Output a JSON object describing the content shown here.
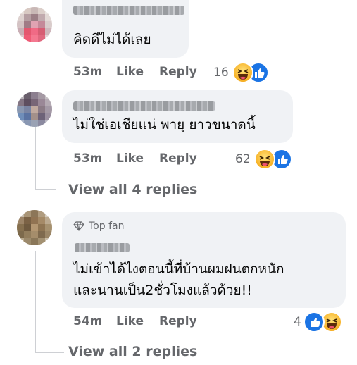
{
  "comments": [
    {
      "text": "คิดดีไม่ได้เลย",
      "time": "53m",
      "like_label": "Like",
      "reply_label": "Reply",
      "reaction_count": "16"
    },
    {
      "text": "ไม่ใช่เอเชียแน่ พายุ ยาวขนาดนี้",
      "time": "53m",
      "like_label": "Like",
      "reply_label": "Reply",
      "reaction_count": "62"
    },
    {
      "badge": "Top fan",
      "text_line1": "ไม่เข้าได้ไงตอนนี้ที่บ้านผมฝนตกหนัก",
      "text_line2": "และนานเป็น2ชั่วโมงแล้วด้วย!!",
      "time": "54m",
      "like_label": "Like",
      "reply_label": "Reply",
      "reaction_count": "4"
    }
  ],
  "view_replies": [
    "View all 4 replies",
    "View all 2 replies"
  ],
  "colors": {
    "bubble": "#f0f2f5",
    "secondary_text": "#65676b",
    "like_blue": "#1b74e4"
  }
}
